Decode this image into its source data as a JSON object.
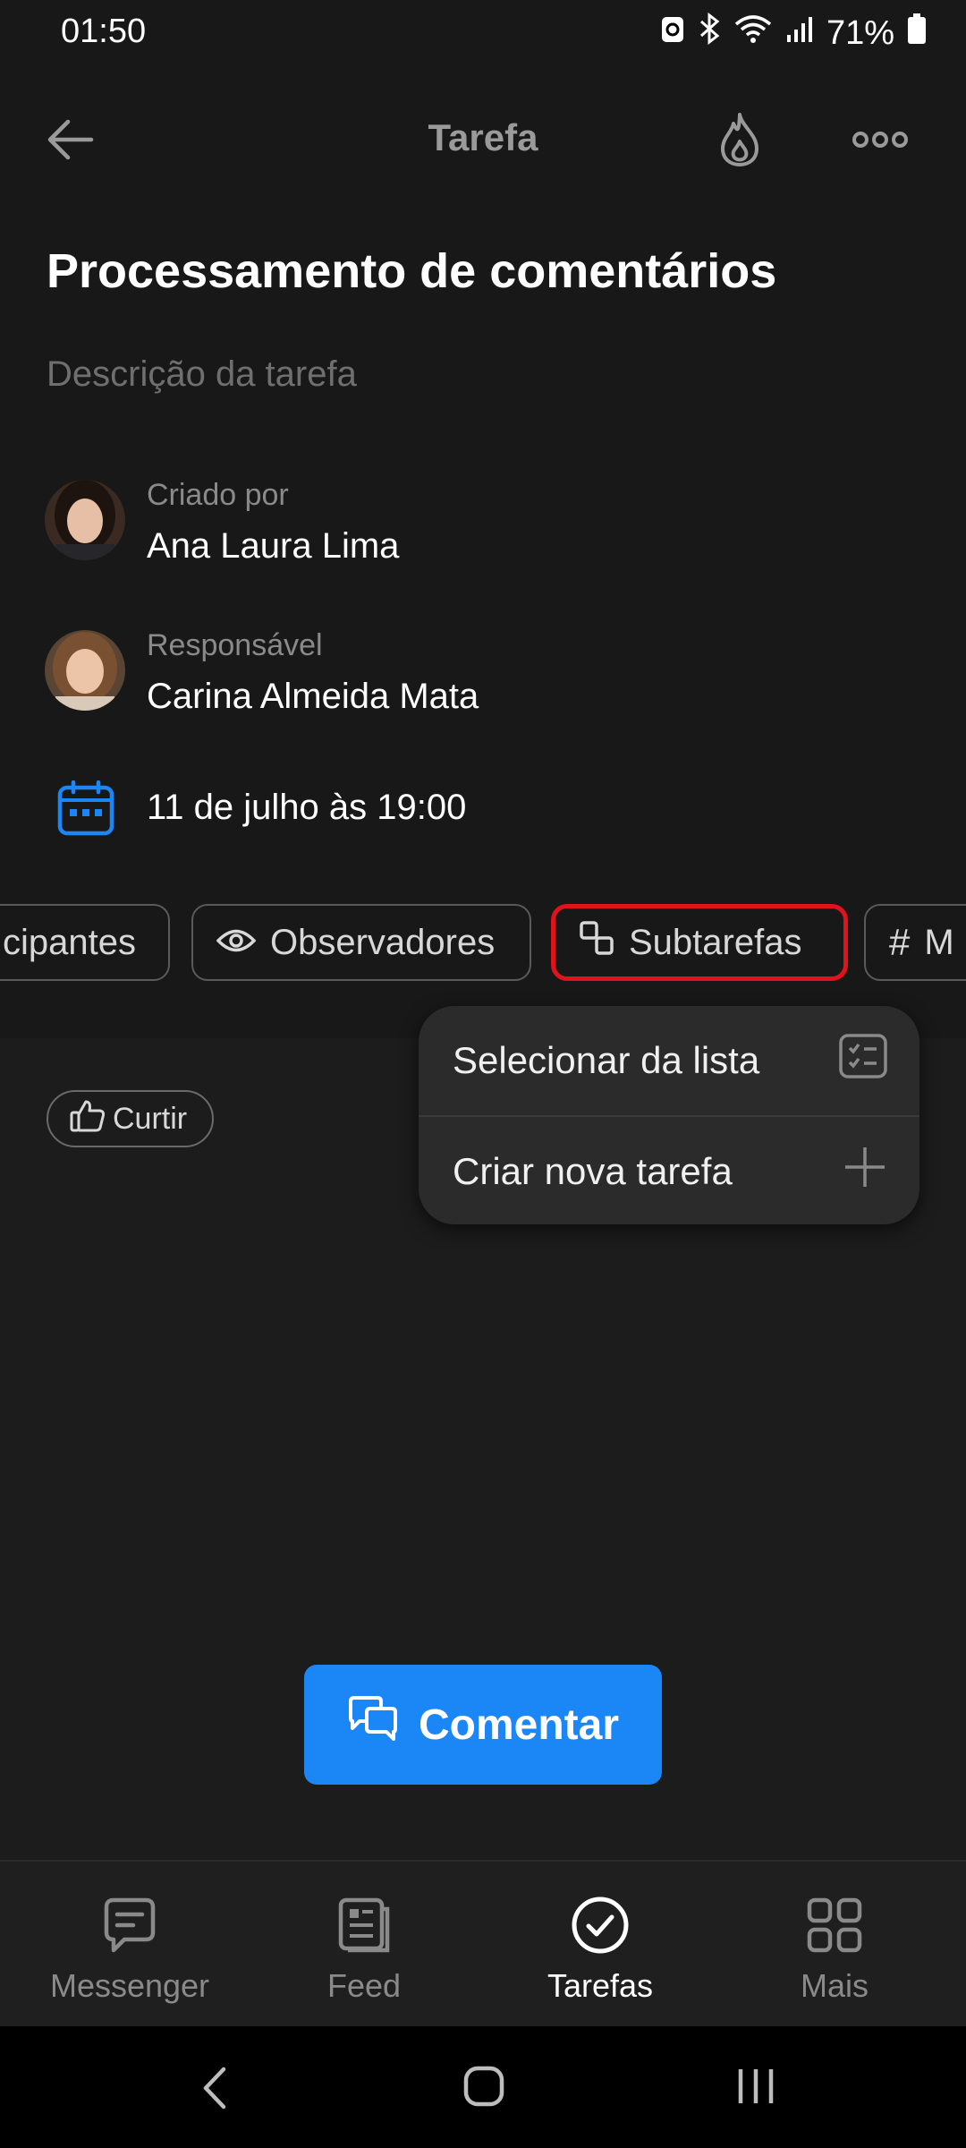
{
  "status": {
    "time": "01:50",
    "battery": "71%"
  },
  "header": {
    "title": "Tarefa"
  },
  "task": {
    "title": "Processamento de comentários",
    "description_placeholder": "Descrição da tarefa",
    "created_by_label": "Criado por",
    "created_by_name": "Ana Laura Lima",
    "responsible_label": "Responsável",
    "responsible_name": "Carina Almeida Mata",
    "deadline": "11 de julho às 19:00"
  },
  "chips": {
    "participants": "cipantes",
    "observers": "Observadores",
    "subtasks": "Subtarefas",
    "tags": "M"
  },
  "subtasks_menu": {
    "select_from_list": "Selecionar da lista",
    "create_new": "Criar nova tarefa"
  },
  "like": {
    "label": "Curtir"
  },
  "comment_button": {
    "label": "Comentar"
  },
  "bottom_nav": {
    "messenger": "Messenger",
    "feed": "Feed",
    "tasks": "Tarefas",
    "more": "Mais"
  },
  "colors": {
    "accent": "#1b86f5",
    "selected_outline": "#e0121a",
    "background": "#181818"
  }
}
